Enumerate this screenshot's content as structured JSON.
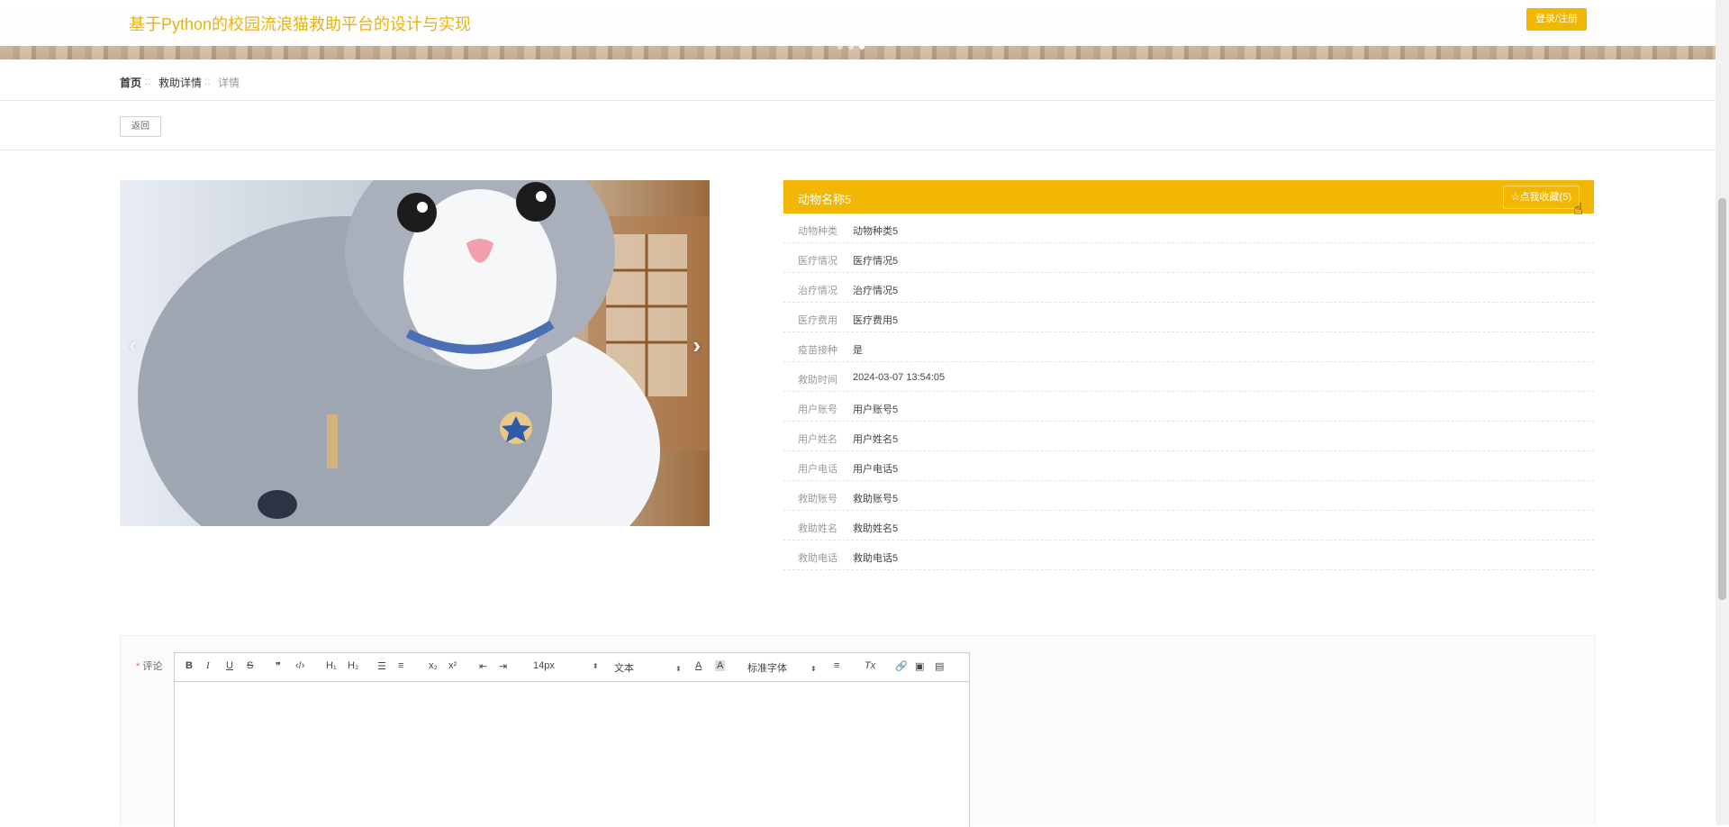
{
  "header": {
    "site_title": "基于Python的校园流浪猫救助平台的设计与实现",
    "login_label": "登录/注册"
  },
  "breadcrumb": {
    "home": "首页",
    "sep": "::",
    "section": "救助详情",
    "current": "详情"
  },
  "back_label": "返回",
  "carousel": {
    "prev": "‹",
    "next": "›"
  },
  "detail": {
    "title": "动物名称5",
    "favorite_label": "☆点我收藏(5)",
    "rows": [
      {
        "k": "动物种类",
        "v": "动物种类5"
      },
      {
        "k": "医疗情况",
        "v": "医疗情况5"
      },
      {
        "k": "治疗情况",
        "v": "治疗情况5"
      },
      {
        "k": "医疗费用",
        "v": "医疗费用5"
      },
      {
        "k": "疫苗接种",
        "v": "是"
      },
      {
        "k": "救助时间",
        "v": "2024-03-07 13:54:05"
      },
      {
        "k": "用户账号",
        "v": "用户账号5"
      },
      {
        "k": "用户姓名",
        "v": "用户姓名5"
      },
      {
        "k": "用户电话",
        "v": "用户电话5"
      },
      {
        "k": "救助账号",
        "v": "救助账号5"
      },
      {
        "k": "救助姓名",
        "v": "救助姓名5"
      },
      {
        "k": "救助电话",
        "v": "救助电话5"
      }
    ]
  },
  "comment": {
    "required_mark": "*",
    "label": "评论",
    "toolbar": {
      "bold": "B",
      "italic": "I",
      "underline": "U",
      "strike": "S",
      "quote": "❞",
      "code": "‹/›",
      "h1": "H₁",
      "h2": "H₂",
      "ordered": "☰",
      "bullet": "≡",
      "sub": "x₂",
      "sup": "x²",
      "outdent": "⇤",
      "indent": "⇥",
      "size": "14px",
      "header": "文本",
      "font": "标准字体",
      "color": "A",
      "bg": "A",
      "align": "≡",
      "clean": "Tx",
      "link": "🔗",
      "image": "▣",
      "video": "▤"
    }
  }
}
